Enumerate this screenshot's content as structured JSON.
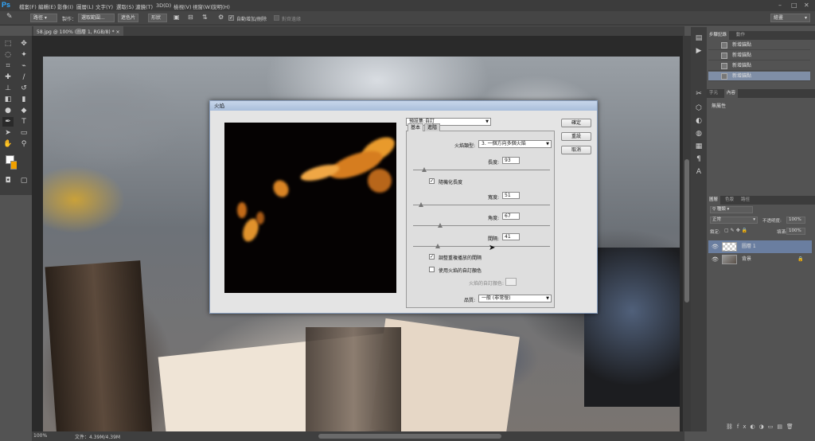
{
  "menubar": {
    "logo": "Ps",
    "items": [
      "檔案(F)",
      "編輯(E)",
      "影像(I)",
      "圖層(L)",
      "文字(Y)",
      "選取(S)",
      "濾鏡(T)",
      "3D(D)",
      "檢視(V)",
      "視窗(W)",
      "說明(H)"
    ],
    "win_controls": [
      "–",
      "□",
      "✕"
    ]
  },
  "optionsbar": {
    "mode_select": "路徑",
    "make_label": "製作：",
    "selection_btn": "選取範圍...",
    "mask_btn": "遮色片",
    "shape_btn": "形狀",
    "auto_add_delete": "自動增加/刪除",
    "align_edges": "對齊邊緣",
    "workspace": "繪畫"
  },
  "document": {
    "tab": "58.jpg @ 100% (圖層 1, RGB/8) *",
    "zoom": "100%",
    "doc_size": "文件：4.39M/4.39M"
  },
  "history_panel": {
    "tabs": [
      "步驟記錄",
      "動作"
    ],
    "rows": [
      "新增錨點",
      "新增錨點",
      "新增錨點",
      "新增錨點"
    ]
  },
  "properties_panel": {
    "tabs": [
      "字元",
      "內容"
    ],
    "text": "無屬性"
  },
  "layers_panel": {
    "tabs": [
      "圖層",
      "色版",
      "路徑"
    ],
    "kind_select": "種類",
    "blend_select": "正常",
    "opacity_label": "不透明度:",
    "opacity_value": "100%",
    "lock_label": "鎖定:",
    "fill_label": "填滿:",
    "fill_value": "100%",
    "layers": [
      {
        "name": "圖層 1",
        "selected": true
      },
      {
        "name": "背景",
        "selected": false
      }
    ]
  },
  "dialog": {
    "title": "火焰",
    "preset_select": "預設集:自訂",
    "tabs": [
      "基本",
      "進階"
    ],
    "flame_type_label": "火焰類型:",
    "flame_type_value": "3. 一個方向多個火焰",
    "length_label": "長度:",
    "length_value": "93",
    "randomize_length_label": "隨機化長度",
    "randomize_length_checked": true,
    "width_label": "寬度:",
    "width_value": "51",
    "angle_label": "角度:",
    "angle_value": "67",
    "interval_label": "間隔:",
    "interval_value": "41",
    "adjust_interval_label": "調整重複播放的間隔",
    "adjust_interval_checked": true,
    "custom_color_label": "使用火焰的自訂顏色",
    "custom_color_checked": false,
    "custom_color_field_label": "火焰的自訂顏色:",
    "quality_label": "品質:",
    "quality_value": "一般 (非常慢)",
    "ok_button": "確定",
    "reset_button": "重設",
    "cancel_button": "取消",
    "slider_levels": {
      "length": 0.08,
      "width": 0.06,
      "angle": 0.2,
      "interval": 0.18
    }
  },
  "colors": {
    "foreground": "#ffffff",
    "background": "#f0a000",
    "selected_history": "#7f8ea6",
    "selected_layer": "#6a7ea0"
  }
}
